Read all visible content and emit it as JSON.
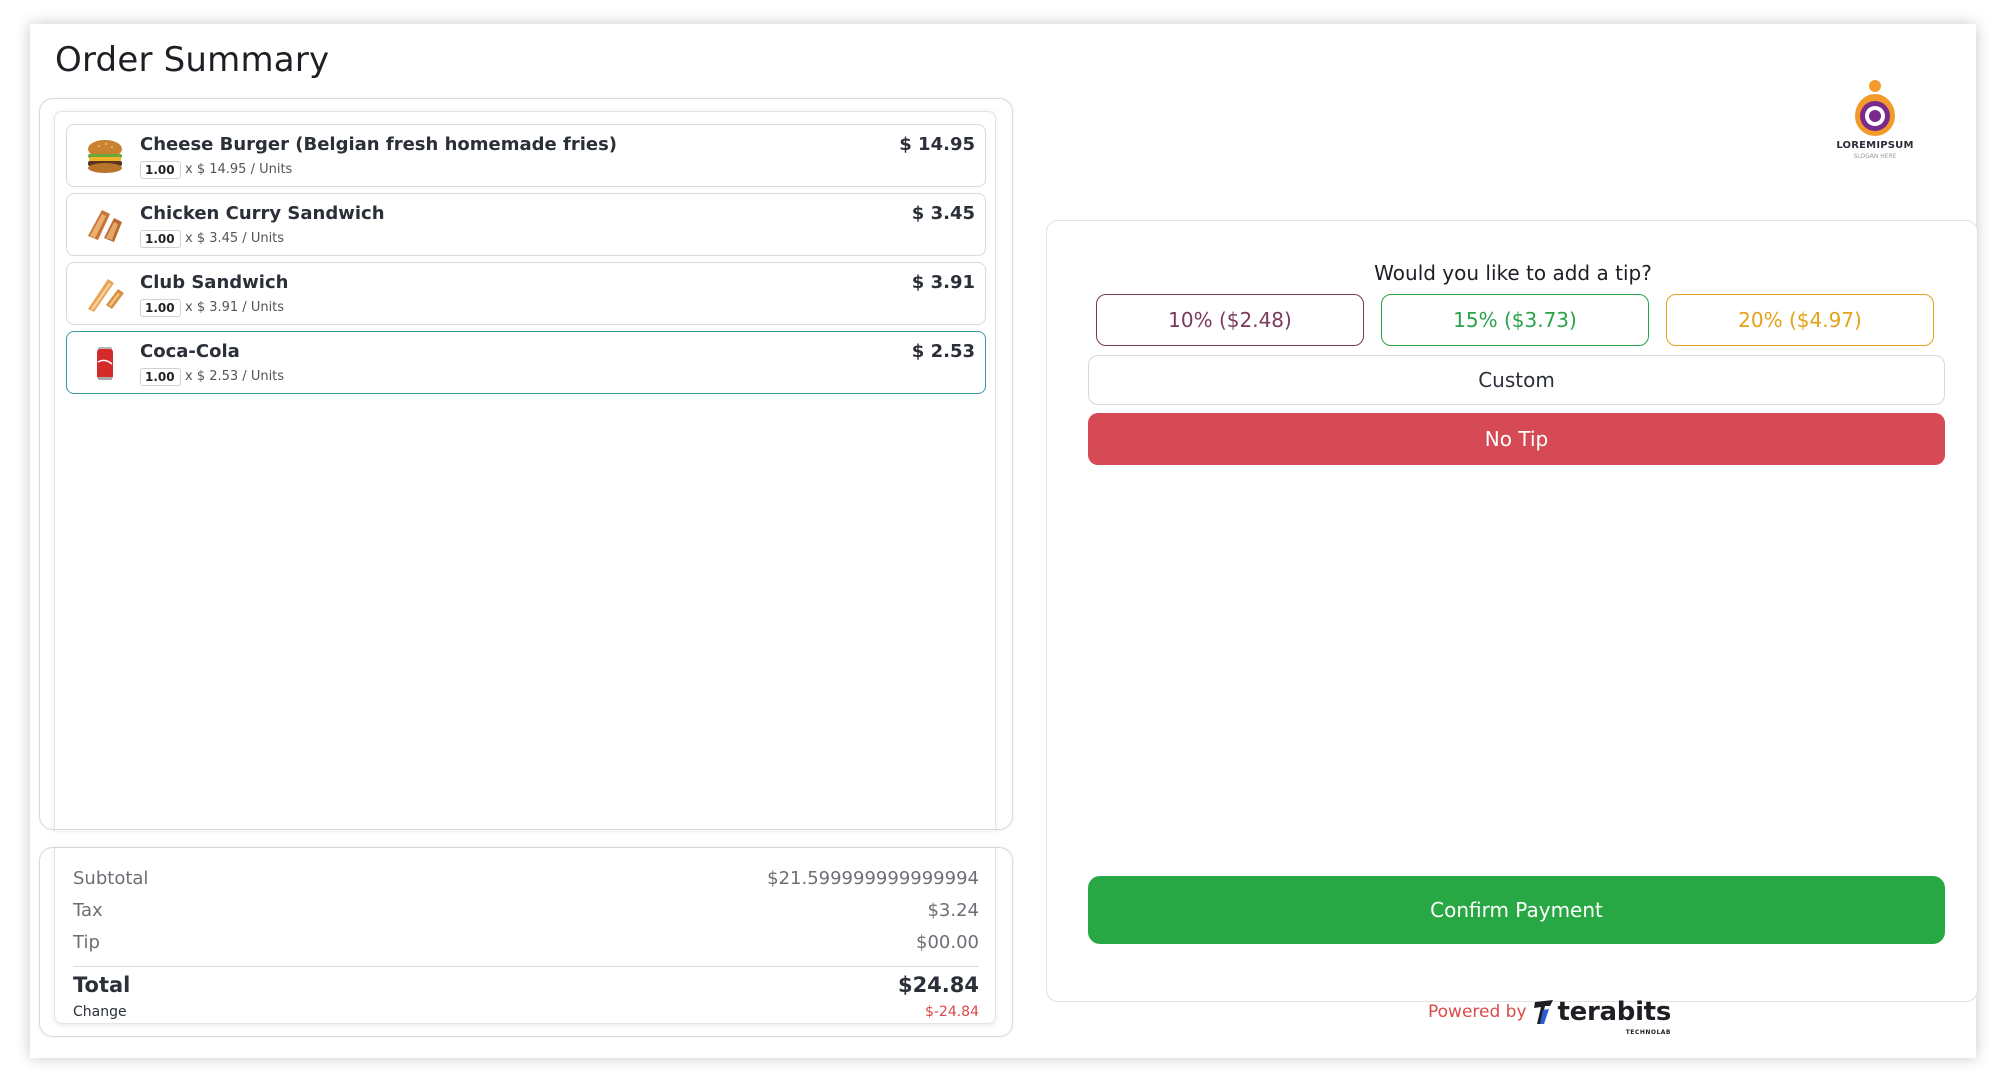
{
  "page": {
    "title": "Order Summary"
  },
  "items": [
    {
      "name": "Cheese Burger (Belgian fresh homemade fries)",
      "qty": "1.00",
      "unit_price": "x $ 14.95 / Units",
      "total": "$ 14.95",
      "icon": "burger-icon",
      "selected": false
    },
    {
      "name": "Chicken Curry Sandwich",
      "qty": "1.00",
      "unit_price": "x $ 3.45 / Units",
      "total": "$ 3.45",
      "icon": "sandwich-icon",
      "selected": false
    },
    {
      "name": "Club Sandwich",
      "qty": "1.00",
      "unit_price": "x $ 3.91 / Units",
      "total": "$ 3.91",
      "icon": "sandwich-icon",
      "selected": false
    },
    {
      "name": "Coca-Cola",
      "qty": "1.00",
      "unit_price": "x $ 2.53 / Units",
      "total": "$ 2.53",
      "icon": "cola-can-icon",
      "selected": true
    }
  ],
  "totals": {
    "subtotal_label": "Subtotal",
    "subtotal_value": "$21.599999999999994",
    "tax_label": "Tax",
    "tax_value": "$3.24",
    "tip_label": "Tip",
    "tip_value": "$00.00",
    "total_label": "Total",
    "total_value": "$24.84",
    "change_label": "Change",
    "change_value": "$-24.84"
  },
  "logo": {
    "text": "LOREMIPSUM",
    "subtext": "SLOGAN HERE"
  },
  "tip": {
    "question": "Would you like to add a tip?",
    "options": [
      "10% ($2.48)",
      "15% ($3.73)",
      "20% ($4.97)"
    ],
    "custom_label": "Custom",
    "no_tip_label": "No Tip",
    "confirm_label": "Confirm Payment"
  },
  "footer": {
    "powered_by": "Powered by",
    "brand": "terabits",
    "brand_sub": "TECHNOLAB"
  },
  "colors": {
    "tip_10": "#7a3a5c",
    "tip_15": "#2aa34a",
    "tip_20": "#e3a21a",
    "no_tip": "#d64a56",
    "confirm": "#28a745",
    "selected_border": "#3a9aa0",
    "change": "#d94a4a"
  }
}
